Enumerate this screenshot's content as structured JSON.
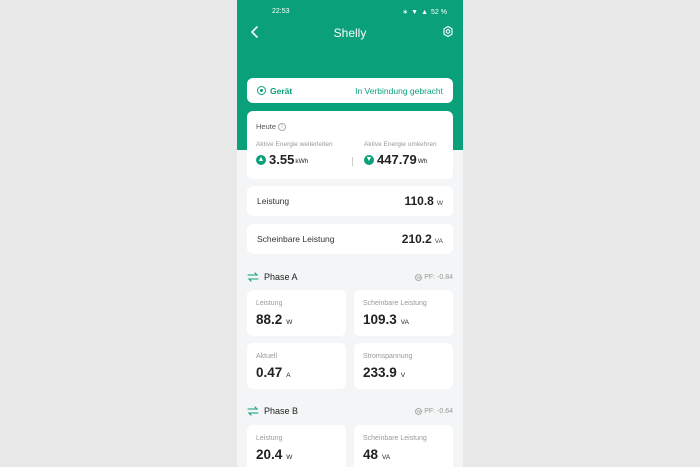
{
  "status_bar": {
    "time": "22:53",
    "battery": "52 %"
  },
  "header": {
    "title": "Shelly",
    "back_icon": "chevron-left-icon",
    "settings_icon": "gear-icon"
  },
  "device": {
    "label": "Gerät",
    "status": "In Verbindung gebracht"
  },
  "today": {
    "title": "Heute",
    "forward": {
      "label": "Aktive Energie weiterleiten",
      "value": "3.55",
      "unit": "kWh"
    },
    "reverse": {
      "label": "Aktive Energie umkehren",
      "value": "447.79",
      "unit": "Wh"
    }
  },
  "power": {
    "label": "Leistung",
    "value": "110.8",
    "unit": "W"
  },
  "apparent_power": {
    "label": "Scheinbare Leistung",
    "value": "210.2",
    "unit": "VA"
  },
  "phase_a": {
    "name": "Phase A",
    "pf": "PF: -0.84",
    "metrics": [
      {
        "label": "Leistung",
        "value": "88.2",
        "unit": "W"
      },
      {
        "label": "Scheinbare Leistung",
        "value": "109.3",
        "unit": "VA"
      },
      {
        "label": "Aktuell",
        "value": "0.47",
        "unit": "A"
      },
      {
        "label": "Stromspannung",
        "value": "233.9",
        "unit": "V"
      }
    ]
  },
  "phase_b": {
    "name": "Phase B",
    "pf": "PF: -0.64",
    "metrics": [
      {
        "label": "Leistung",
        "value": "20.4",
        "unit": "W"
      },
      {
        "label": "Scheinbare Leistung",
        "value": "48",
        "unit": "VA"
      }
    ]
  },
  "colors": {
    "accent": "#0aa07a",
    "background": "#f4f5f6"
  }
}
